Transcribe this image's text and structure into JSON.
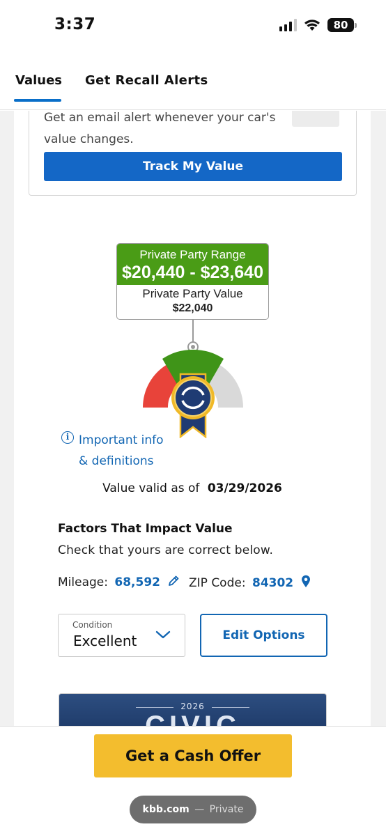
{
  "status_bar": {
    "time": "3:37",
    "battery": "80"
  },
  "tabs": [
    {
      "label": "Values",
      "active": true
    },
    {
      "label": "Get Recall Alerts",
      "active": false
    }
  ],
  "alert_card": {
    "text": "Get an email alert whenever your car's value changes.",
    "button_label": "Track My Value"
  },
  "valuation": {
    "range_label": "Private Party Range",
    "range_amount": "$20,440 - $23,640",
    "value_label": "Private Party Value",
    "value_amount": "$22,040"
  },
  "info_link": {
    "line1": "Important info",
    "line2": "& definitions"
  },
  "valid_as_of": {
    "label": "Value valid as of",
    "date": "03/29/2026"
  },
  "factors": {
    "title": "Factors That Impact Value",
    "subtitle": "Check that yours are correct below.",
    "mileage_label": "Mileage:",
    "mileage_value": "68,592",
    "zip_label": "ZIP Code:",
    "zip_value": "84302"
  },
  "condition": {
    "label": "Condition",
    "value": "Excellent"
  },
  "edit_options_label": "Edit Options",
  "promo": {
    "year": "2026",
    "model": "CIVIC"
  },
  "cash_offer_label": "Get a Cash Offer",
  "browser": {
    "domain": "kbb.com",
    "separator": "—",
    "mode": "Private"
  },
  "colors": {
    "accent_blue": "#1467c6",
    "range_green": "#4a9c16",
    "cash_offer_yellow": "#f3bd2e",
    "gauge_red": "#e8433a",
    "gauge_grey": "#d9d9d9",
    "badge_navy": "#1f3b73",
    "badge_gold": "#f0b928"
  },
  "icons": [
    "signal-icon",
    "wifi-icon",
    "battery-icon",
    "info-icon",
    "pencil-icon",
    "map-pin-icon",
    "chevron-down-icon",
    "kbb-badge-icon"
  ]
}
